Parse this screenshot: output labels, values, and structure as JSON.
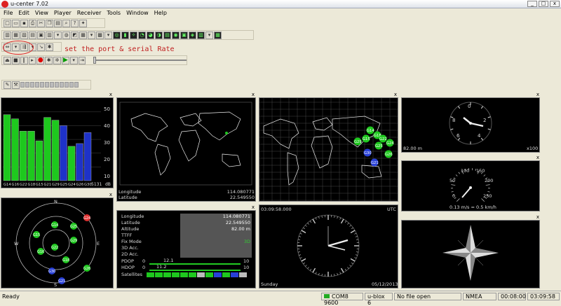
{
  "window": {
    "title": "u-center 7.02",
    "controls": [
      "_",
      "□",
      "x"
    ]
  },
  "menu": [
    "File",
    "Edit",
    "View",
    "Player",
    "Receiver",
    "Tools",
    "Window",
    "Help"
  ],
  "annotation": "set the port & serial Rate",
  "signal_panel": {
    "sats": [
      "G14",
      "G16",
      "G22",
      "G18",
      "G15",
      "G21",
      "G29",
      "G25",
      "G24",
      "G26",
      "G30"
    ],
    "levels": [
      48,
      45,
      36,
      36,
      29,
      46,
      44,
      40,
      25,
      27,
      35
    ],
    "colors": [
      "#1ec81e",
      "#1ec81e",
      "#1ec81e",
      "#1ec81e",
      "#1ec81e",
      "#1ec81e",
      "#1ec81e",
      "#1e32c8",
      "#1ec81e",
      "#1e32c8",
      "#1e32c8"
    ],
    "ticks": [
      "50",
      "40",
      "30",
      "20",
      "10"
    ],
    "time": "5131",
    "unit": "dB"
  },
  "map_small": {
    "lon_label": "Longitude",
    "lon": "114.080771",
    "lat_label": "Latitude",
    "lat": "22.549550"
  },
  "sky": {
    "dirs": {
      "n": "N",
      "s": "S",
      "e": "E",
      "w": "W"
    },
    "sats": [
      {
        "id": "G24",
        "color": "#e03030"
      },
      {
        "id": "G14",
        "color": "#1ec81e"
      },
      {
        "id": "G25",
        "color": "#1ec81e"
      },
      {
        "id": "G15",
        "color": "#1ec81e"
      },
      {
        "id": "G22",
        "color": "#1ec81e"
      },
      {
        "id": "G29",
        "color": "#1ec81e"
      },
      {
        "id": "G18",
        "color": "#1ec81e"
      },
      {
        "id": "G16",
        "color": "#1ec81e"
      },
      {
        "id": "G26",
        "color": "#1ec81e"
      },
      {
        "id": "G30",
        "color": "#2840d8"
      },
      {
        "id": "G21",
        "color": "#2840d8"
      }
    ]
  },
  "data_panel": {
    "rows": [
      {
        "label": "Longitude",
        "value": "114.080771"
      },
      {
        "label": "Latitude",
        "value": "22.549550"
      },
      {
        "label": "Altitude",
        "value": "82.00 m"
      },
      {
        "label": "TTFF",
        "value": ""
      },
      {
        "label": "Fix Mode",
        "value": "3D"
      },
      {
        "label": "3D Acc.",
        "value": ""
      },
      {
        "label": "2D Acc.",
        "value": ""
      },
      {
        "label": "PDOP",
        "value": "10"
      },
      {
        "label": "HDOP",
        "value": "10"
      },
      {
        "label": "Satellites",
        "value": ""
      }
    ],
    "pdop": {
      "min": "0",
      "val": "12.1",
      "max": "10"
    },
    "hdop": {
      "min": "0",
      "val": "11.2",
      "max": "10"
    }
  },
  "world_map": {
    "sats": [
      {
        "id": "G14",
        "color": "#1ec81e"
      },
      {
        "id": "G18",
        "color": "#1ec81e"
      },
      {
        "id": "G15",
        "color": "#1ec81e"
      },
      {
        "id": "G29",
        "color": "#1ec81e"
      },
      {
        "id": "G22",
        "color": "#1ec81e"
      },
      {
        "id": "G25",
        "color": "#1ec81e"
      },
      {
        "id": "G24",
        "color": "#1ec81e"
      },
      {
        "id": "G26",
        "color": "#1ec81e"
      },
      {
        "id": "G30",
        "color": "#2840d8"
      },
      {
        "id": "G21",
        "color": "#2840d8"
      }
    ]
  },
  "clock": {
    "time": "03:09:58.000",
    "tz": "UTC",
    "day": "Sunday",
    "date": "05/12/2013"
  },
  "altimeter": {
    "ticks": [
      "0",
      "8",
      "6",
      "4",
      "2"
    ],
    "value": "82.00 m",
    "scale": "x100"
  },
  "speedometer": {
    "ticks": [
      "0",
      "50",
      "100",
      "150",
      "200",
      "250"
    ],
    "readout": "0.13 m/s = 0.5 km/h"
  },
  "status": {
    "ready": "Ready",
    "port": "COM8 9600",
    "receiver": "u-blox 6",
    "file": "No file open",
    "protocol": "NMEA",
    "elapsed": "00:08:00",
    "clock": "03:09:58"
  }
}
